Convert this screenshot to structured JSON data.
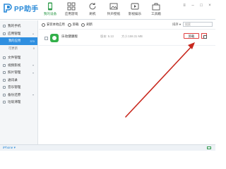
{
  "app": {
    "name": "PP助手",
    "accent": "#2a8ad8"
  },
  "tabs": [
    {
      "label": "我的设备",
      "active": true,
      "icon": "phone-icon"
    },
    {
      "label": "应用游戏",
      "active": false,
      "icon": "grid-icon"
    },
    {
      "label": "刷机",
      "active": false,
      "icon": "refresh-icon"
    },
    {
      "label": "铃声壁纸",
      "active": false,
      "icon": "picture-icon"
    },
    {
      "label": "影视娱乐",
      "active": false,
      "icon": "film-icon"
    },
    {
      "label": "工具箱",
      "active": false,
      "icon": "toolbox-icon"
    }
  ],
  "window": {
    "menu": "≡",
    "minimize": "–",
    "maximize": "□",
    "close": "×"
  },
  "sidebar": {
    "items": [
      {
        "label": "我的手机",
        "type": "main"
      },
      {
        "label": "应用管理",
        "type": "main"
      },
      {
        "label": "我的应用",
        "type": "sub-active",
        "count": "370"
      },
      {
        "label": "可更新",
        "type": "sub",
        "count": "0"
      },
      {
        "label": "文件管理",
        "type": "main"
      },
      {
        "label": "视频影视",
        "type": "main"
      },
      {
        "label": "照片管理",
        "type": "main"
      },
      {
        "label": "通讯录",
        "type": "main"
      },
      {
        "label": "音乐管理",
        "type": "main"
      },
      {
        "label": "备份还原",
        "type": "main"
      },
      {
        "label": "垃圾清理",
        "type": "main"
      }
    ]
  },
  "toolbar": {
    "install_label": "安装本地应用",
    "uninstall_label": "卸载",
    "refresh_label": "刷新",
    "sort_label": "排序 ▾",
    "search_placeholder": "搜索"
  },
  "apps": [
    {
      "name": "乐动健康版",
      "version": "版本: 5.13",
      "size": "大小:158.31 MB",
      "action": "卸载"
    }
  ],
  "bottom": {
    "device": "iPhone ▾"
  }
}
